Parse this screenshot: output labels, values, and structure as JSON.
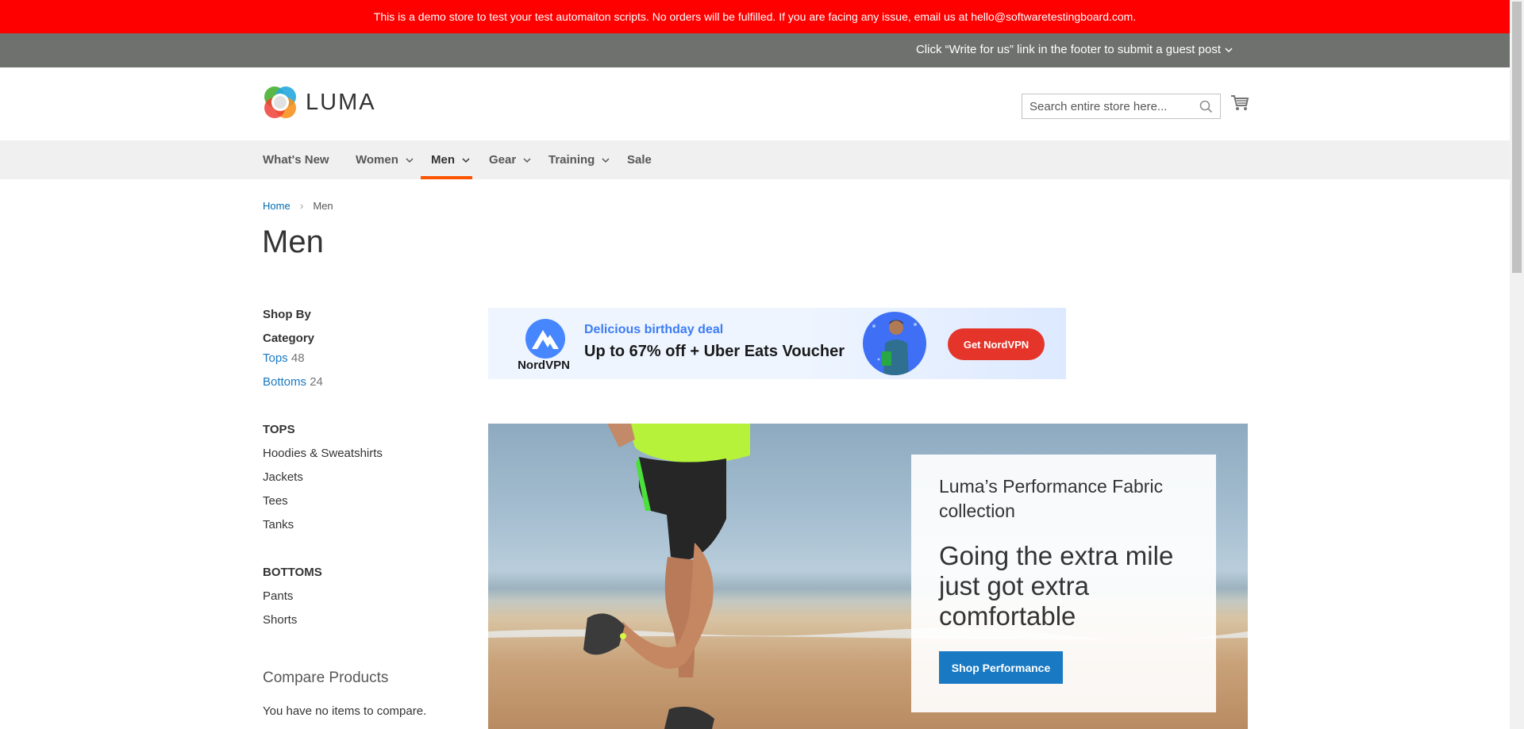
{
  "demo_notice": "This is a demo store to test your test automaiton scripts. No orders will be fulfilled. If you are facing any issue, email us at hello@softwaretestingboard.com.",
  "guest_post": "Click “Write for us” link in the footer to submit a guest post",
  "header": {
    "logo_text": "LUMA",
    "search_placeholder": "Search entire store here...",
    "cart_icon": "shopping-cart-icon"
  },
  "nav": {
    "items": [
      {
        "label": "What's New",
        "has_dropdown": false
      },
      {
        "label": "Women",
        "has_dropdown": true
      },
      {
        "label": "Men",
        "has_dropdown": true,
        "active": true
      },
      {
        "label": "Gear",
        "has_dropdown": true
      },
      {
        "label": "Training",
        "has_dropdown": true
      },
      {
        "label": "Sale",
        "has_dropdown": false
      }
    ],
    "active_color": "#ff5501"
  },
  "breadcrumb": {
    "home": "Home",
    "separator": "›",
    "current": "Men"
  },
  "page_title": "Men",
  "sidebar": {
    "shop_by": "Shop By",
    "category_heading": "Category",
    "categories": [
      {
        "label": "Tops",
        "count": "48"
      },
      {
        "label": "Bottoms",
        "count": "24"
      }
    ],
    "tops": {
      "heading": "TOPS",
      "items": [
        "Hoodies & Sweatshirts",
        "Jackets",
        "Tees",
        "Tanks"
      ]
    },
    "bottoms": {
      "heading": "BOTTOMS",
      "items": [
        "Pants",
        "Shorts"
      ]
    },
    "compare_title": "Compare Products",
    "compare_empty": "You have no items to compare."
  },
  "ad": {
    "brand": "NordVPN",
    "eyebrow": "Delicious birthday deal",
    "headline": "Up to 67% off + Uber Eats Voucher",
    "cta": "Get NordVPN",
    "cta_color": "#e5352a"
  },
  "hero": {
    "subtitle": "Luma’s Performance Fabric collection",
    "title": "Going the extra mile just got extra comfortable",
    "button": "Shop Performance",
    "button_color": "#1979c3"
  },
  "colors": {
    "demo_bar": "#ff0000",
    "guest_bar": "#6e716e",
    "link": "#1979c3"
  }
}
